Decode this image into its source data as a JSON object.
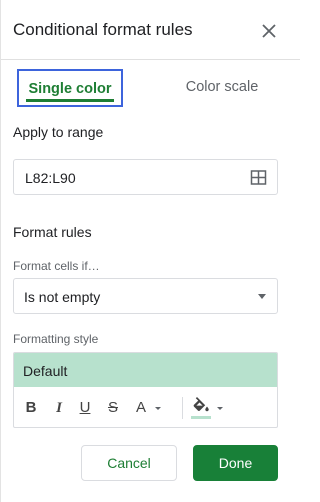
{
  "panel": {
    "title": "Conditional format rules"
  },
  "tabs": [
    {
      "label": "Single color",
      "active": true
    },
    {
      "label": "Color scale",
      "active": false
    }
  ],
  "apply_to_range": {
    "label": "Apply to range",
    "value": "L82:L90",
    "icon": "grid-icon"
  },
  "format_rules": {
    "label": "Format rules",
    "condition_label": "Format cells if…",
    "condition_value": "Is not empty"
  },
  "formatting_style": {
    "label": "Formatting style",
    "preview_text": "Default",
    "fill_color": "#b7e1cd",
    "toolbar": {
      "bold": "B",
      "italic": "I",
      "underline": "U",
      "strikethrough": "S",
      "text_color": "A",
      "fill_icon": "paint-bucket-icon"
    }
  },
  "actions": {
    "cancel": "Cancel",
    "done": "Done"
  },
  "colors": {
    "accent_green": "#188038",
    "tab_green": "#1e7e34",
    "highlight_outline": "#3d64dc"
  }
}
